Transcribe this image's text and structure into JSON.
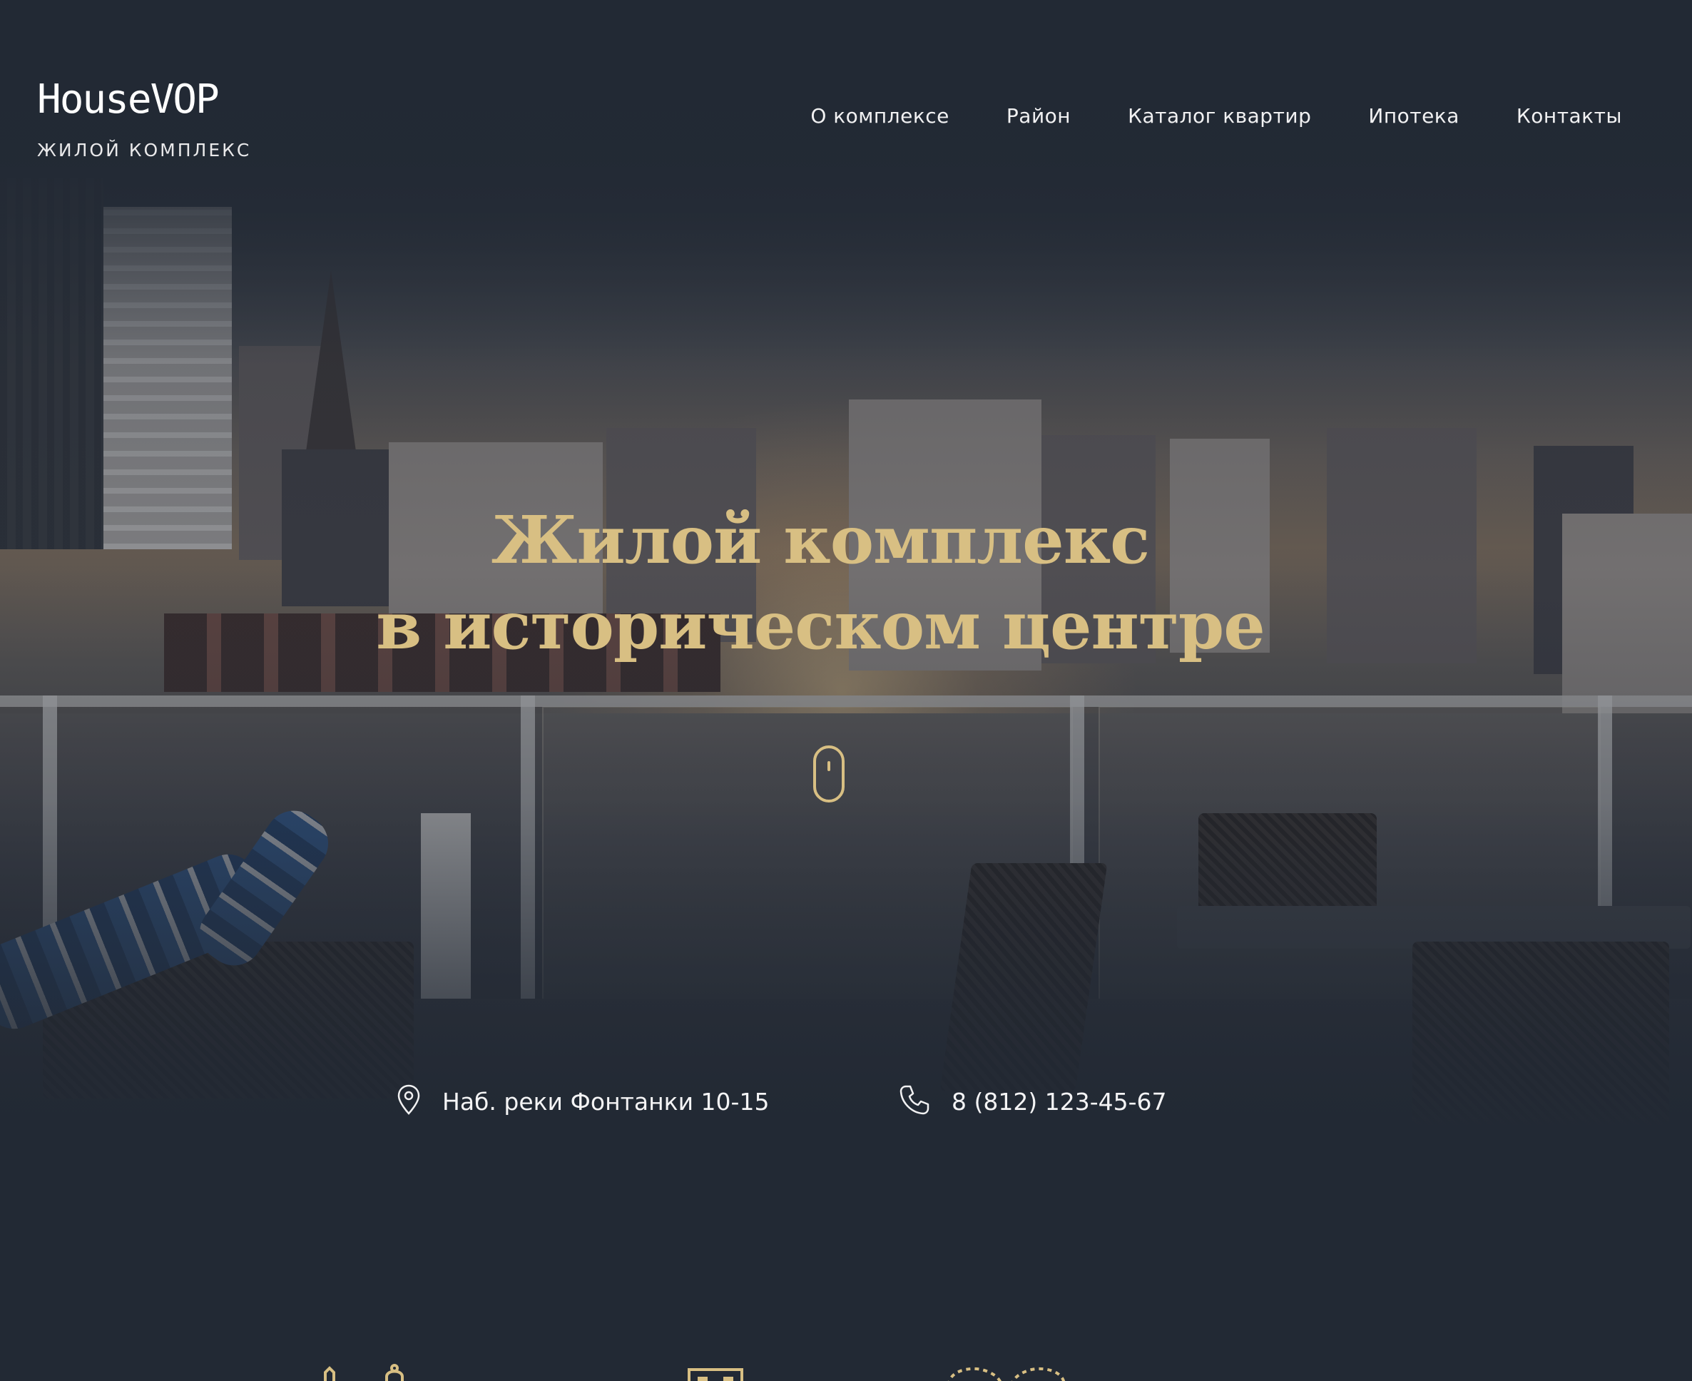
{
  "header": {
    "logo_name": "HouseVOP",
    "logo_subtitle": "ЖИЛОЙ КОМПЛЕКС"
  },
  "nav": {
    "items": [
      {
        "label": "О комплексе"
      },
      {
        "label": "Район"
      },
      {
        "label": "Каталог квартир"
      },
      {
        "label": "Ипотека"
      },
      {
        "label": "Контакты"
      }
    ]
  },
  "hero": {
    "title_line1": "Жилой комплекс",
    "title_line2": "в историческом центре",
    "scroll_icon": "mouse-scroll-icon"
  },
  "contacts": {
    "address": "Наб. реки Фонтанки 10-15",
    "address_icon": "location-pin-icon",
    "phone": "8 (812) 123-45-67",
    "phone_icon": "phone-icon"
  },
  "features": {
    "icons": [
      "building-icon",
      "document-icon",
      "rings-icon"
    ]
  },
  "colors": {
    "background": "#222934",
    "accent_gold": "#d8bf83",
    "text_light": "#f1f1f2"
  }
}
